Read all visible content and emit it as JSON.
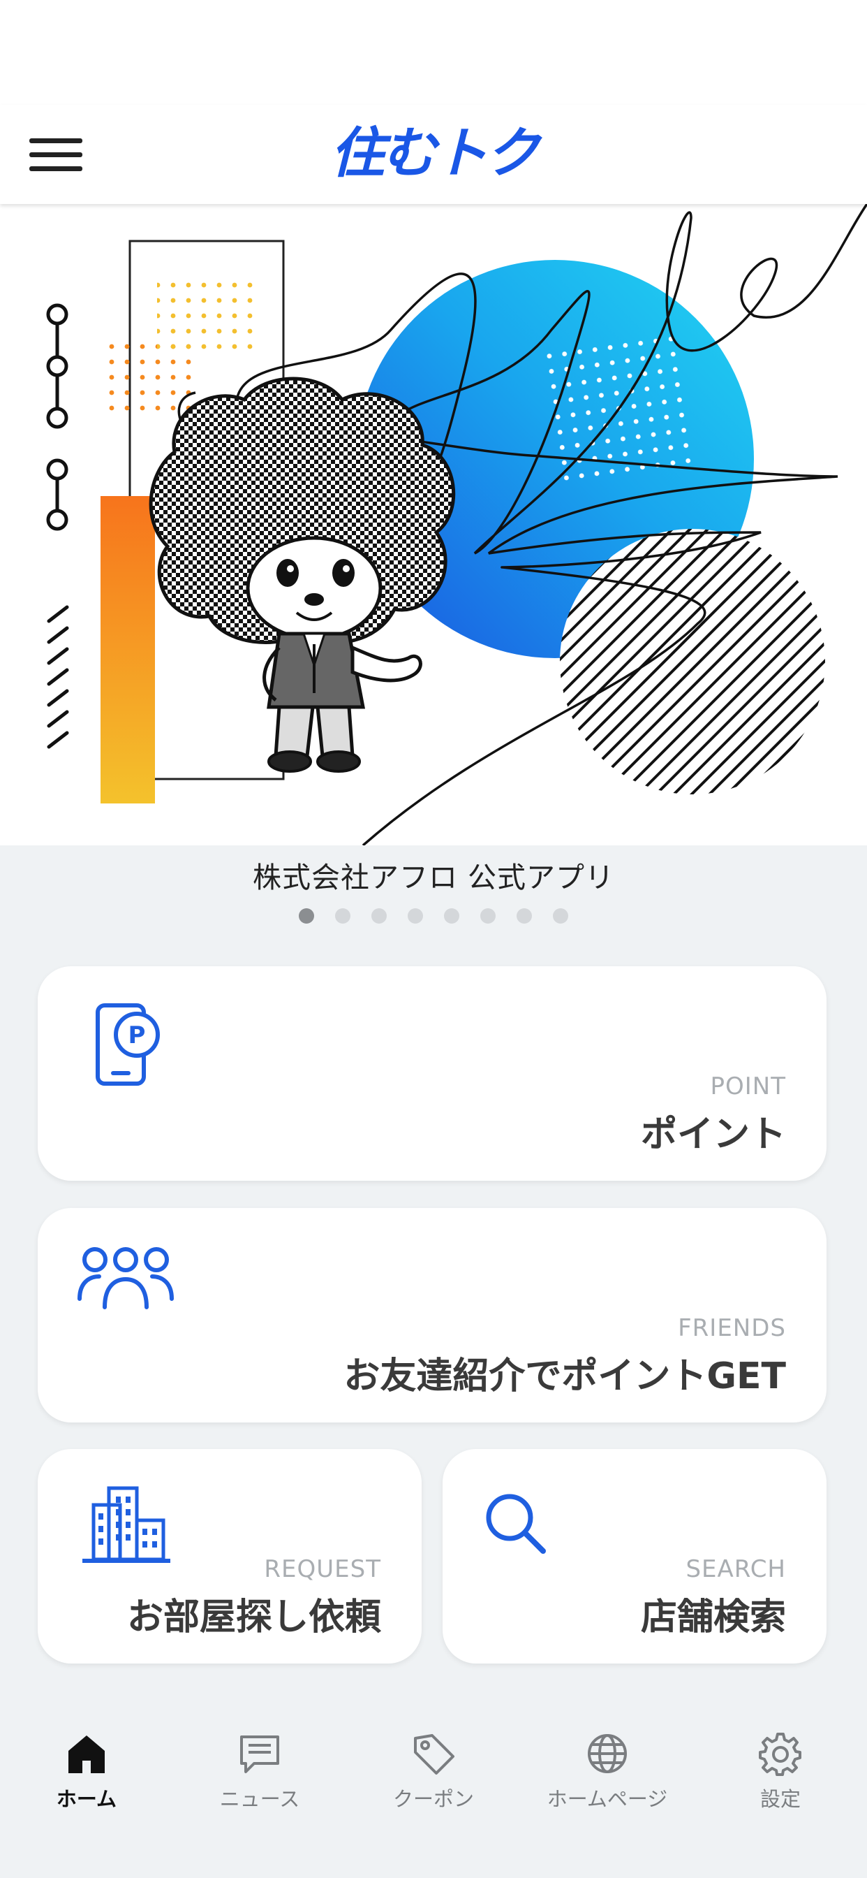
{
  "header": {
    "logo_text": "住むトク"
  },
  "hero": {
    "caption": "株式会社アフロ 公式アプリ",
    "slide_count": 8,
    "active_slide": 1
  },
  "cards": {
    "point": {
      "en": "POINT",
      "jp": "ポイント"
    },
    "friends": {
      "en": "FRIENDS",
      "jp": "お友達紹介でポイントGET"
    },
    "request": {
      "en": "REQUEST",
      "jp": "お部屋探し依頼"
    },
    "search": {
      "en": "SEARCH",
      "jp": "店舗検索"
    }
  },
  "tabbar": {
    "items": [
      {
        "label": "ホーム",
        "icon": "home-icon"
      },
      {
        "label": "ニュース",
        "icon": "news-icon"
      },
      {
        "label": "クーポン",
        "icon": "coupon-icon"
      },
      {
        "label": "ホームページ",
        "icon": "globe-icon"
      },
      {
        "label": "設定",
        "icon": "gear-icon"
      }
    ],
    "active": "ホーム"
  },
  "colors": {
    "accent": "#1a57e6",
    "icon_blue": "#1f5fe0",
    "background": "#eff2f4"
  }
}
